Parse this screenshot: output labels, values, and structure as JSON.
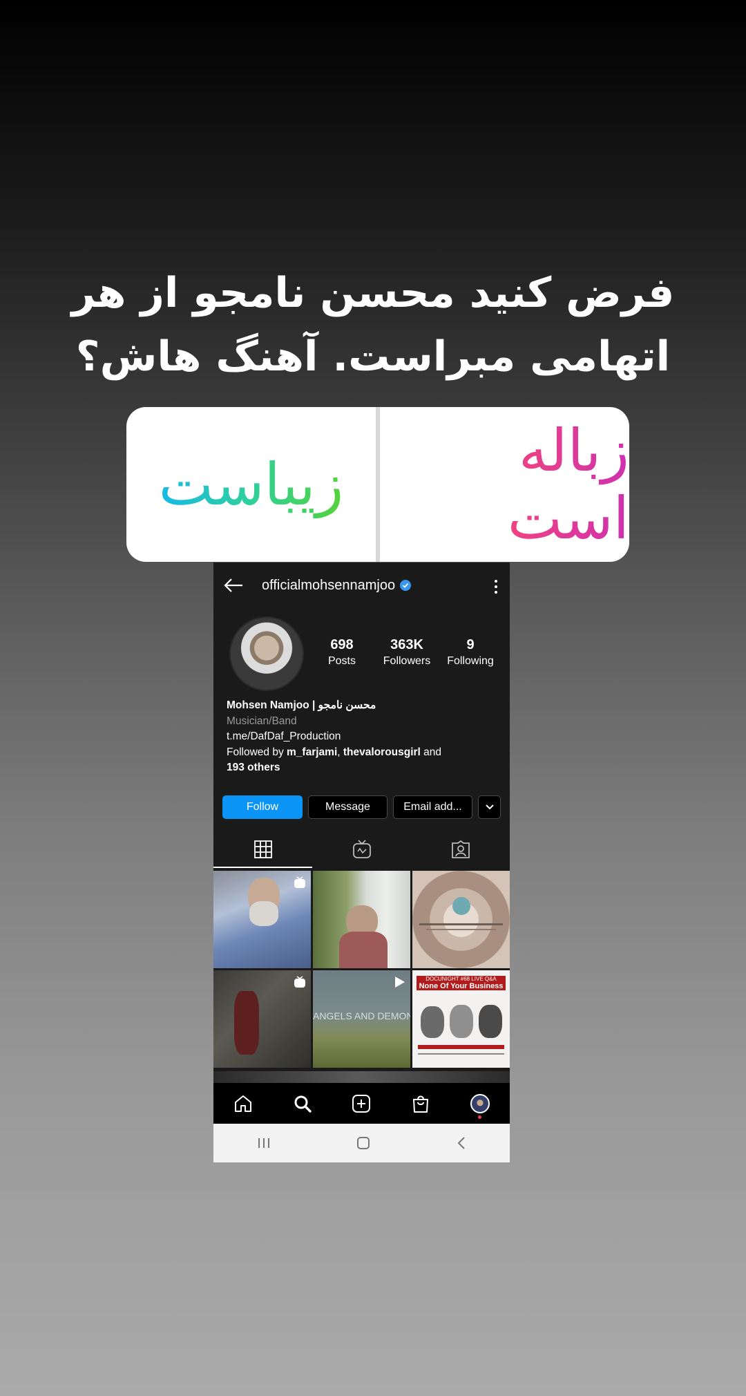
{
  "story": {
    "question": "فرض کنید محسن نامجو از هر اتهامی مبراست. آهنگ هاش؟",
    "poll": {
      "option_right": "زباله است",
      "option_left": "زیباست"
    }
  },
  "profile": {
    "username": "officialmohsennamjoo",
    "stats": [
      {
        "value": "698",
        "label": "Posts"
      },
      {
        "value": "363K",
        "label": "Followers"
      },
      {
        "value": "9",
        "label": "Following"
      }
    ],
    "display_name": "Mohsen Namjoo | محسن نامجو",
    "category": "Musician/Band",
    "link": "t.me/DafDaf_Production",
    "followed_by_prefix": "Followed by",
    "followed_by_user1": "m_farjami",
    "followed_by_sep": ",",
    "followed_by_user2": "thevalorousgirl",
    "followed_by_and": "and",
    "followed_by_others": "193 others",
    "buttons": {
      "follow": "Follow",
      "message": "Message",
      "email": "Email add..."
    },
    "tabs": [
      "grid-icon",
      "igtv-icon",
      "tagged-icon"
    ],
    "grid": {
      "post5_text": "ANGELS AND DEMONS",
      "post6_head_small": "DOCUNIGHT #68 LIVE Q&A",
      "post6_head_big": "None Of Your Business"
    }
  },
  "navbar": [
    "home-icon",
    "search-icon",
    "new-post-icon",
    "shop-icon",
    "profile-avatar"
  ],
  "colors": {
    "follow_button": "#0a95f6",
    "poll_right_gradient": [
      "#f0884a",
      "#f0447e",
      "#d030b0"
    ],
    "poll_left_gradient": [
      "#16b9e6",
      "#2fd09b",
      "#55d23a"
    ],
    "verified": "#3897f0"
  }
}
